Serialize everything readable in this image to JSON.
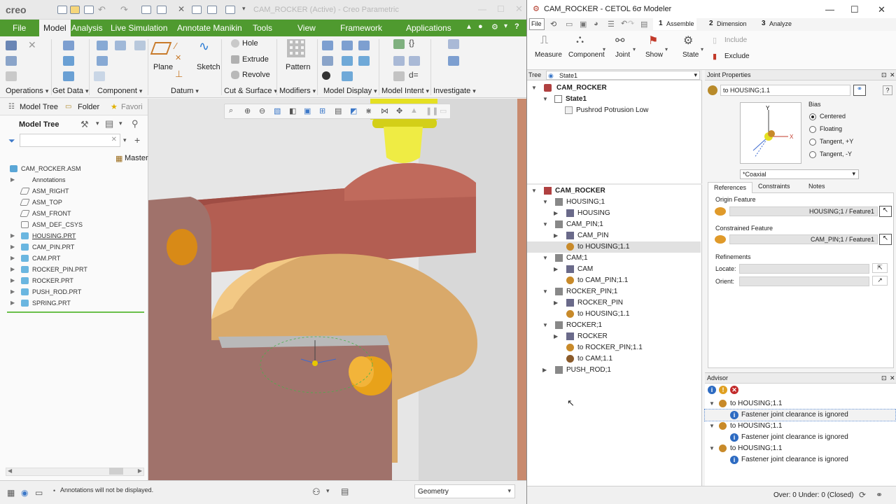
{
  "creo": {
    "title": "CAM_ROCKER (Active) - Creo Parametric",
    "logo": "creo",
    "tabs": [
      "File",
      "Model",
      "Analysis",
      "Live Simulation",
      "Annotate Manikin",
      "Tools",
      "View",
      "Framework",
      "Applications"
    ],
    "active_tab": "Model",
    "ribbon": {
      "datum": {
        "plane": "Plane",
        "sketch": "Sketch",
        "group": "Datum"
      },
      "cut_surface": {
        "hole": "Hole",
        "extrude": "Extrude",
        "revolve": "Revolve",
        "group": "Cut & Surface"
      },
      "modifiers": {
        "pattern": "Pattern",
        "group": "Modifiers"
      },
      "groups": [
        "Operations",
        "Get Data",
        "Component",
        "Model Display",
        "Model Intent",
        "Investigate"
      ]
    },
    "panel_tabs": [
      "Model Tree",
      "Folder",
      "Favori"
    ],
    "model_tree_label": "Model Tree",
    "master_label": "Master",
    "tree": [
      {
        "label": "CAM_ROCKER.ASM",
        "expand": "",
        "icon": "assembly-icon"
      },
      {
        "label": "Annotations",
        "expand": "▶",
        "icon": ""
      },
      {
        "label": "ASM_RIGHT",
        "expand": "",
        "icon": "datum-plane-icon"
      },
      {
        "label": "ASM_TOP",
        "expand": "",
        "icon": "datum-plane-icon"
      },
      {
        "label": "ASM_FRONT",
        "expand": "",
        "icon": "datum-plane-icon"
      },
      {
        "label": "ASM_DEF_CSYS",
        "expand": "",
        "icon": "csys-icon"
      },
      {
        "label": "HOUSING.PRT",
        "expand": "▶",
        "icon": "part-icon"
      },
      {
        "label": "CAM_PIN.PRT",
        "expand": "▶",
        "icon": "part-icon"
      },
      {
        "label": "CAM.PRT",
        "expand": "▶",
        "icon": "part-icon"
      },
      {
        "label": "ROCKER_PIN.PRT",
        "expand": "▶",
        "icon": "part-icon"
      },
      {
        "label": "ROCKER.PRT",
        "expand": "▶",
        "icon": "part-icon"
      },
      {
        "label": "PUSH_ROD.PRT",
        "expand": "▶",
        "icon": "part-icon"
      },
      {
        "label": "SPRING.PRT",
        "expand": "▶",
        "icon": "flexible-part-icon"
      }
    ],
    "status_message": "Annotations will not be displayed.",
    "filter_value": "Geometry"
  },
  "cetol": {
    "title": "CAM_ROCKER - CETOL 6σ Modeler",
    "file_label": "File",
    "steps": [
      {
        "num": "1",
        "label": "Assemble"
      },
      {
        "num": "2",
        "label": "Dimension"
      },
      {
        "num": "3",
        "label": "Analyze"
      }
    ],
    "ribbon": [
      "Measure",
      "Component",
      "Joint",
      "Show",
      "State"
    ],
    "include_label": "Include",
    "exclude_label": "Exclude",
    "tree_label": "Tree",
    "state_select": "State1",
    "state_tree": {
      "root": "CAM_ROCKER",
      "state": "State1",
      "item": "Pushrod Potrusion Low"
    },
    "assembly_tree": [
      {
        "label": "CAM_ROCKER",
        "level": 0,
        "expand": "▼",
        "icon": "assembly"
      },
      {
        "label": "HOUSING;1",
        "level": 1,
        "expand": "▼",
        "icon": "instance"
      },
      {
        "label": "HOUSING",
        "level": 2,
        "expand": "▶",
        "icon": "part"
      },
      {
        "label": "CAM_PIN;1",
        "level": 1,
        "expand": "▼",
        "icon": "instance"
      },
      {
        "label": "CAM_PIN",
        "level": 2,
        "expand": "▶",
        "icon": "part"
      },
      {
        "label": "to HOUSING;1.1",
        "level": 2,
        "expand": "",
        "icon": "joint",
        "selected": true
      },
      {
        "label": "CAM;1",
        "level": 1,
        "expand": "▼",
        "icon": "instance"
      },
      {
        "label": "CAM",
        "level": 2,
        "expand": "▶",
        "icon": "part"
      },
      {
        "label": "to CAM_PIN;1.1",
        "level": 2,
        "expand": "",
        "icon": "joint"
      },
      {
        "label": "ROCKER_PIN;1",
        "level": 1,
        "expand": "▼",
        "icon": "instance"
      },
      {
        "label": "ROCKER_PIN",
        "level": 2,
        "expand": "▶",
        "icon": "part"
      },
      {
        "label": "to HOUSING;1.1",
        "level": 2,
        "expand": "",
        "icon": "joint"
      },
      {
        "label": "ROCKER;1",
        "level": 1,
        "expand": "▼",
        "icon": "instance"
      },
      {
        "label": "ROCKER",
        "level": 2,
        "expand": "▶",
        "icon": "part"
      },
      {
        "label": "to ROCKER_PIN;1.1",
        "level": 2,
        "expand": "",
        "icon": "joint"
      },
      {
        "label": "to CAM;1.1",
        "level": 2,
        "expand": "",
        "icon": "contact"
      },
      {
        "label": "PUSH_ROD;1",
        "level": 1,
        "expand": "▶",
        "icon": "instance"
      }
    ],
    "joint_props": {
      "header": "Joint Properties",
      "name_value": "to HOUSING;1.1",
      "bias_label": "Bias",
      "bias_options": [
        "Centered",
        "Floating",
        "Tangent, +Y",
        "Tangent, -Y"
      ],
      "bias_selected": "Centered",
      "joint_type": "*Coaxial",
      "tabs": [
        "References",
        "Constraints",
        "Notes"
      ],
      "origin_feature_label": "Origin Feature",
      "origin_feature_value": "HOUSING;1 / Feature1",
      "constrained_feature_label": "Constrained Feature",
      "constrained_feature_value": "CAM_PIN;1 / Feature1",
      "refinements_label": "Refinements",
      "locate_label": "Locate:",
      "orient_label": "Orient:"
    },
    "advisor": {
      "header": "Advisor",
      "items": [
        {
          "joint": "to HOUSING;1.1",
          "message": "Fastener joint clearance is ignored"
        },
        {
          "joint": "to HOUSING;1.1",
          "message": "Fastener joint clearance is ignored"
        },
        {
          "joint": "to HOUSING;1.1",
          "message": "Fastener joint clearance is ignored"
        }
      ]
    },
    "status": "Over: 0 Under: 0 (Closed)"
  },
  "colors": {
    "creo_green": "#4f9a2f",
    "housing": "#a0726b",
    "cam": "#d9aa6e",
    "rocker": "#b05c50",
    "pin": "#e8a21a",
    "pushrod": "#e5e022"
  }
}
